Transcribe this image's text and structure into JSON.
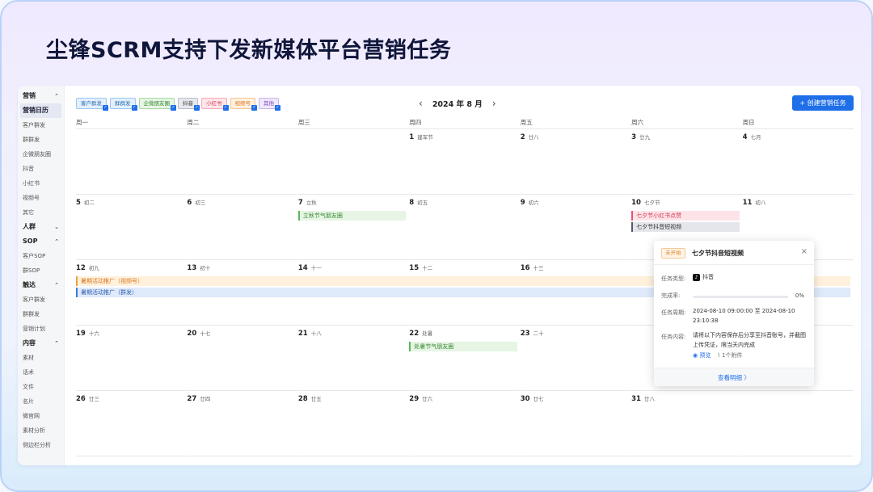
{
  "headline": "尘锋SCRM支持下发新媒体平台营销任务",
  "sidebar": [
    {
      "type": "group",
      "label": "营销",
      "chev": "^"
    },
    {
      "type": "item",
      "label": "营销日历",
      "active": true
    },
    {
      "type": "item",
      "label": "客户群发"
    },
    {
      "type": "item",
      "label": "群群发"
    },
    {
      "type": "item",
      "label": "企微朋友圈"
    },
    {
      "type": "item",
      "label": "抖音"
    },
    {
      "type": "item",
      "label": "小红书"
    },
    {
      "type": "item",
      "label": "视频号"
    },
    {
      "type": "item",
      "label": "其它"
    },
    {
      "type": "group",
      "label": "人群",
      "chev": "v"
    },
    {
      "type": "group",
      "label": "SOP",
      "chev": "^"
    },
    {
      "type": "item",
      "label": "客户SOP"
    },
    {
      "type": "item",
      "label": "群SOP"
    },
    {
      "type": "group",
      "label": "触达",
      "chev": "^"
    },
    {
      "type": "item",
      "label": "客户群发"
    },
    {
      "type": "item",
      "label": "群群发"
    },
    {
      "type": "item",
      "label": "营销计划"
    },
    {
      "type": "group",
      "label": "内容",
      "chev": "^"
    },
    {
      "type": "item",
      "label": "素材"
    },
    {
      "type": "item",
      "label": "话术"
    },
    {
      "type": "item",
      "label": "文件"
    },
    {
      "type": "item",
      "label": "名片"
    },
    {
      "type": "item",
      "label": "微官网"
    },
    {
      "type": "item",
      "label": "素材分析"
    },
    {
      "type": "item",
      "label": "侧边栏分析"
    }
  ],
  "chips": [
    {
      "label": "客户群发",
      "bg": "#e3f0fc",
      "border": "#9cc6ee",
      "color": "#2f6fb0"
    },
    {
      "label": "群群发",
      "bg": "#e3f0fc",
      "border": "#9cc6ee",
      "color": "#2f6fb0"
    },
    {
      "label": "企微朋友圈",
      "bg": "#e6f5e4",
      "border": "#a9d8a0",
      "color": "#3b8a33"
    },
    {
      "label": "抖音",
      "bg": "#e8e9ee",
      "border": "#b8bcc8",
      "color": "#333"
    },
    {
      "label": "小红书",
      "bg": "#fde6ea",
      "border": "#f4a9b5",
      "color": "#d43a55"
    },
    {
      "label": "视频号",
      "bg": "#fff1e0",
      "border": "#f6c58c",
      "color": "#d9761f"
    },
    {
      "label": "其他",
      "bg": "#f1e8fb",
      "border": "#cdb2ee",
      "color": "#7a48c2"
    }
  ],
  "nav": {
    "prev": "‹",
    "title": "2024 年 8 月",
    "next": "›"
  },
  "create_button": "+ 创建营销任务",
  "weekdays": [
    "周一",
    "周二",
    "周三",
    "周四",
    "周五",
    "周六",
    "周日"
  ],
  "weeks": [
    [
      {
        "d": "",
        "l": ""
      },
      {
        "d": "",
        "l": ""
      },
      {
        "d": "",
        "l": ""
      },
      {
        "d": "1",
        "l": "建军节"
      },
      {
        "d": "2",
        "l": "廿八"
      },
      {
        "d": "3",
        "l": "廿九"
      },
      {
        "d": "4",
        "l": "七月"
      }
    ],
    [
      {
        "d": "5",
        "l": "初二"
      },
      {
        "d": "6",
        "l": "初三"
      },
      {
        "d": "7",
        "l": "立秋"
      },
      {
        "d": "8",
        "l": "初五"
      },
      {
        "d": "9",
        "l": "初六"
      },
      {
        "d": "10",
        "l": "七夕节"
      },
      {
        "d": "11",
        "l": "初八"
      }
    ],
    [
      {
        "d": "12",
        "l": "初九"
      },
      {
        "d": "13",
        "l": "初十"
      },
      {
        "d": "14",
        "l": "十一"
      },
      {
        "d": "15",
        "l": "十二"
      },
      {
        "d": "16",
        "l": "十三"
      },
      {
        "d": "",
        "l": ""
      },
      {
        "d": "",
        "l": ""
      }
    ],
    [
      {
        "d": "19",
        "l": "十六"
      },
      {
        "d": "20",
        "l": "十七"
      },
      {
        "d": "21",
        "l": "十八"
      },
      {
        "d": "22",
        "l": "处暑"
      },
      {
        "d": "23",
        "l": "二十"
      },
      {
        "d": "",
        "l": ""
      },
      {
        "d": "",
        "l": ""
      }
    ],
    [
      {
        "d": "26",
        "l": "廿三"
      },
      {
        "d": "27",
        "l": "廿四"
      },
      {
        "d": "28",
        "l": "廿五"
      },
      {
        "d": "29",
        "l": "廿六"
      },
      {
        "d": "30",
        "l": "廿七"
      },
      {
        "d": "31",
        "l": "廿八"
      },
      {
        "d": "",
        "l": ""
      }
    ]
  ],
  "events": [
    {
      "label": "立秋节气朋友圈",
      "week": 1,
      "col": 2,
      "span": 1,
      "slot": 0,
      "kind": "green"
    },
    {
      "label": "七夕节小红书点赞",
      "week": 1,
      "col": 5,
      "span": 1,
      "slot": 0,
      "kind": "pink"
    },
    {
      "label": "七夕节抖音短视频",
      "week": 1,
      "col": 5,
      "span": 1,
      "slot": 1,
      "kind": "gray"
    },
    {
      "label": "暑期活动推广（视频号）",
      "week": 2,
      "col": 0,
      "span": 7,
      "slot": 0,
      "kind": "orange"
    },
    {
      "label": "暑期活动推广（群发）",
      "week": 2,
      "col": 0,
      "span": 7,
      "slot": 1,
      "kind": "blue"
    },
    {
      "label": "处暑节气朋友圈",
      "week": 3,
      "col": 3,
      "span": 1,
      "slot": 0,
      "kind": "green"
    }
  ],
  "event_styles": {
    "green": {
      "bg": "#e6f5e4",
      "border": "#5cb85c",
      "color": "#3b8a33"
    },
    "pink": {
      "bg": "#fde3e8",
      "border": "#e0556e",
      "color": "#d43a55"
    },
    "gray": {
      "bg": "#e4e6ec",
      "border": "#555a66",
      "color": "#333"
    },
    "orange": {
      "bg": "#fff1dc",
      "border": "#f0a040",
      "color": "#d9761f"
    },
    "blue": {
      "bg": "#dfeafb",
      "border": "#3c7be0",
      "color": "#2f5fb0"
    }
  },
  "popover": {
    "status": "未开始",
    "title": "七夕节抖音短视频",
    "close": "×",
    "type_label": "任务类型:",
    "type_icon": "♪",
    "type_value": "抖音",
    "progress_label": "完成率:",
    "progress_fraction": 0,
    "progress_text": "0%",
    "period_label": "任务周期:",
    "period_value": "2024-08-10 09:00:00 至 2024-08-10 23:10:38",
    "content_label": "任务内容:",
    "content_value": "请将以下内容保存后分享至抖音账号，并截图上传凭证，限当天内完成",
    "preview": "预览",
    "attachments": "1个附件",
    "detail": "查看明细 〉"
  }
}
